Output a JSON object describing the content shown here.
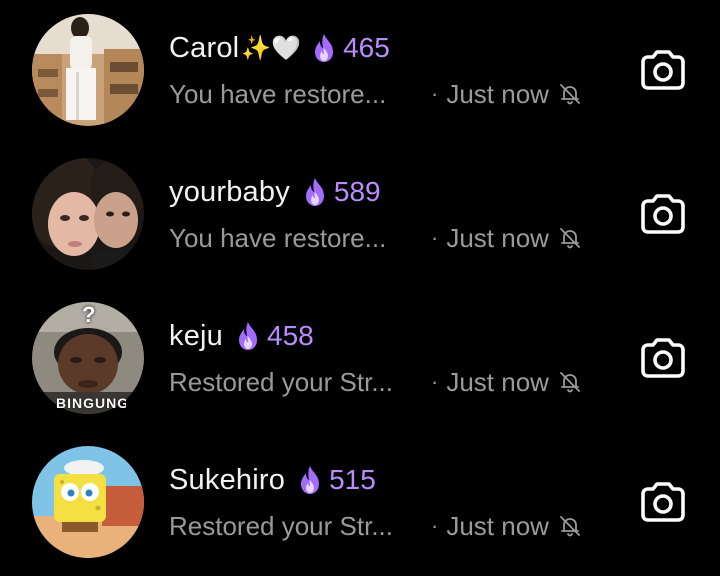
{
  "conversations": [
    {
      "name": "Carol",
      "emojis": "✨🤍",
      "streak": "465",
      "preview": "You have restore...",
      "separator": "·",
      "time": "Just now",
      "avatar": "avatar-photo-carol",
      "icon": "camera-icon"
    },
    {
      "name": "yourbaby",
      "emojis": "",
      "streak": "589",
      "preview": "You have restore...",
      "separator": "·",
      "time": "Just now",
      "avatar": "avatar-photo-yourbaby",
      "icon": "camera-icon"
    },
    {
      "name": "keju",
      "emojis": "",
      "streak": "458",
      "preview": "Restored your Str...",
      "separator": "·",
      "time": "Just now",
      "avatar": "avatar-photo-keju",
      "avatar_caption": "BINGUNG",
      "avatar_mark": "?",
      "icon": "camera-icon"
    },
    {
      "name": "Sukehiro",
      "emojis": "",
      "streak": "515",
      "preview": "Restored your Str...",
      "separator": "·",
      "time": "Just now",
      "avatar": "avatar-photo-sukehiro",
      "icon": "camera-icon"
    }
  ],
  "colors": {
    "background": "#000000",
    "name": "#f2f2f2",
    "streak": "#b98cff",
    "secondary": "#9a9a9a",
    "flame": "#a46bff"
  },
  "icons": {
    "streak": "flame-icon",
    "muted": "bell-off-icon",
    "action": "camera-icon"
  }
}
